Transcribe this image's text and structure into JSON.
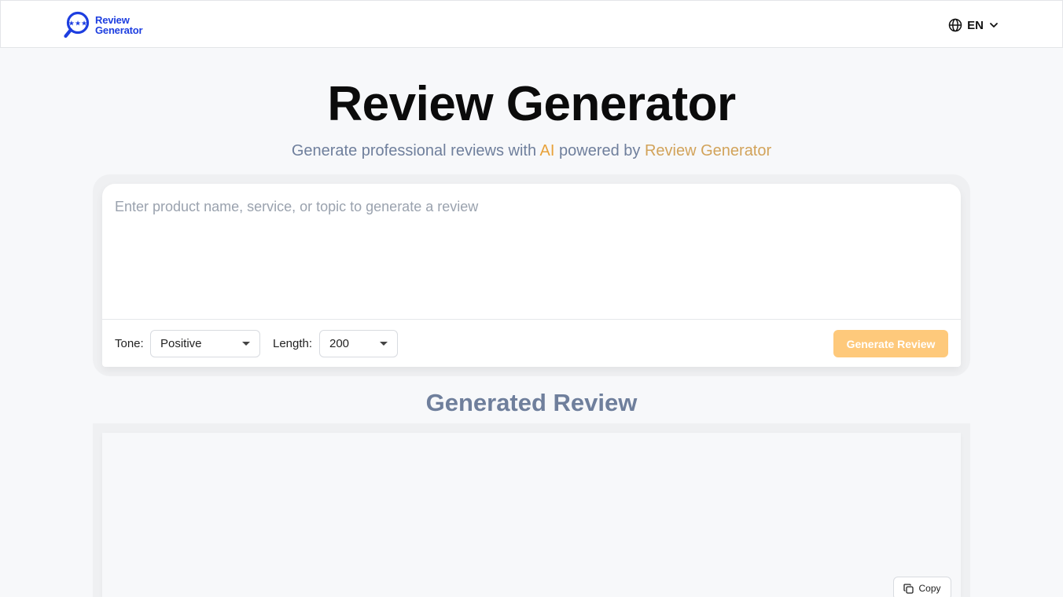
{
  "header": {
    "logo_line1": "Review",
    "logo_line2": "Generator",
    "language": "EN",
    "icons": [
      "magnifier-star-logo-icon",
      "globe-icon",
      "chevron-down-icon"
    ]
  },
  "hero": {
    "title": "Review Generator",
    "subtitle_part1": "Generate professional reviews with ",
    "subtitle_ai": "AI",
    "subtitle_part2": " powered by ",
    "subtitle_brand": "Review Generator"
  },
  "form": {
    "topic_placeholder": "Enter product name, service, or topic to generate a review",
    "topic_value": "",
    "tone_label": "Tone:",
    "tone_value": "Positive",
    "length_label": "Length:",
    "length_value": "200",
    "generate_label": "Generate Review"
  },
  "output": {
    "title": "Generated Review",
    "content": "",
    "copy_label": "Copy"
  },
  "colors": {
    "brand_blue": "#1d3ee0",
    "accent_orange": "#e8a23a",
    "button_disabled": "#fec97b",
    "muted_text": "#6f7f9c"
  }
}
